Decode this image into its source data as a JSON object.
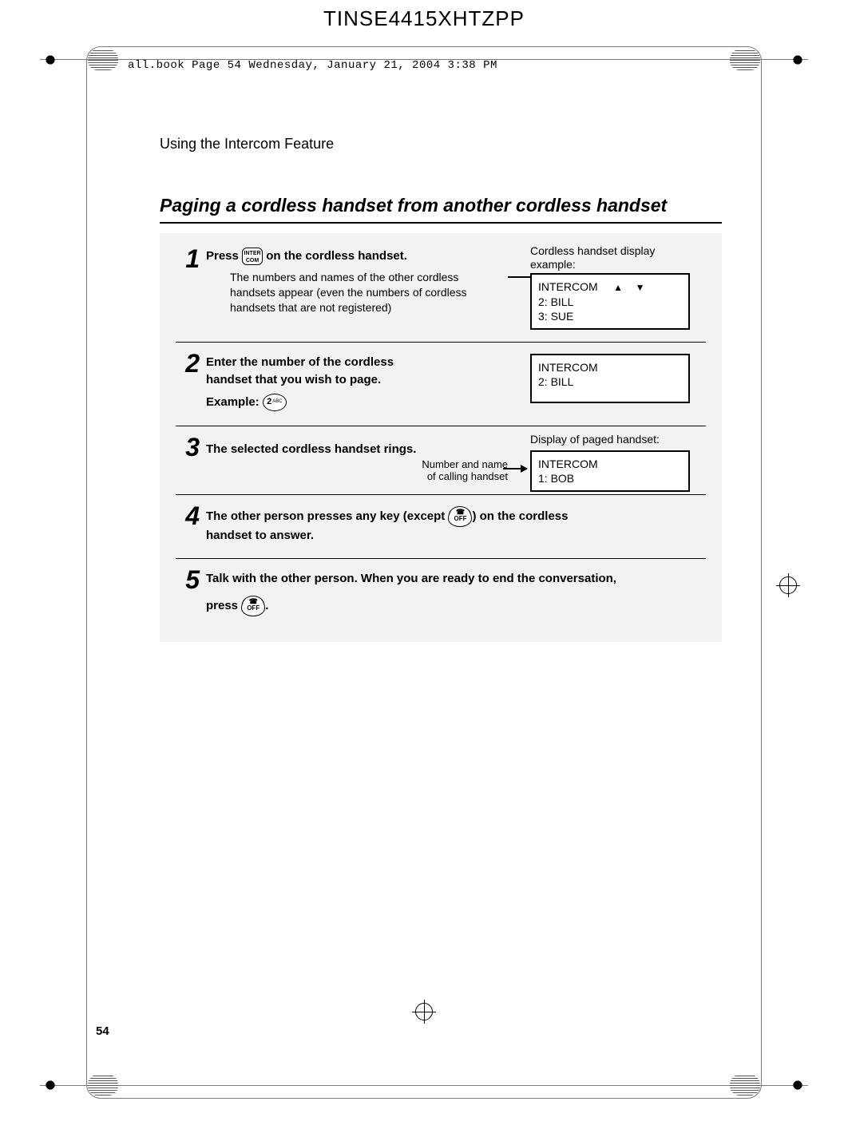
{
  "doc": {
    "header_code": "TINSE4415XHTZPP",
    "print_meta": "all.book  Page 54  Wednesday, January 21, 2004  3:38 PM",
    "section_title": "Using the Intercom Feature",
    "heading": "Paging a cordless handset from another cordless handset",
    "page_number": "54"
  },
  "icons": {
    "intercom_top": "INTER",
    "intercom_bot": "COM",
    "two_main": "2",
    "two_sub": "ABC",
    "off_label": "OFF",
    "phone_glyph": "☎"
  },
  "steps": {
    "s1": {
      "line_pre": "Press ",
      "line_post": " on the cordless handset.",
      "sub": "The numbers and names of the other cordless handsets appear (even the numbers of cordless handsets that are not registered)",
      "caption": "Cordless handset display example:",
      "display_l1": "INTERCOM",
      "display_tri_up": "▲",
      "display_tri_dn": "▼",
      "display_l2": "2: BILL",
      "display_l3": "3: SUE"
    },
    "s2": {
      "l1": "Enter the number of the cordless",
      "l2": "handset that you wish to page.",
      "example_label": "Example: ",
      "display_l1": "INTERCOM",
      "display_l2": "2: BILL"
    },
    "s3": {
      "l1": "The selected cordless handset rings.",
      "caption": "Display of paged handset:",
      "numname_l1": "Number and name",
      "numname_l2": "of calling handset",
      "display_l1": "INTERCOM",
      "display_l2": "1: BOB"
    },
    "s4": {
      "pre": "The other person presses any key (except ",
      "post": ") on the cordless",
      "l2": "handset to answer."
    },
    "s5": {
      "l1": "Talk with the other person. When you are ready to end the conversation,",
      "l2_pre": "press ",
      "l2_post": "."
    }
  }
}
